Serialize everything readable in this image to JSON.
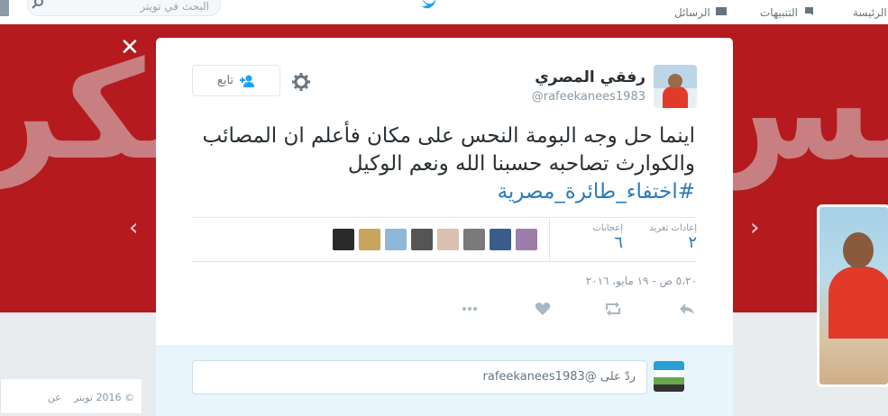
{
  "nav": {
    "home_label": "الرئيسة",
    "notifications_label": "التنبيهات",
    "messages_label": "الرسائل",
    "search_placeholder": "البحث في تويتر"
  },
  "icons": {
    "close": "close-icon",
    "settings": "gear-icon",
    "follow": "add-user-icon",
    "reply": "reply-icon",
    "retweet": "retweet-icon",
    "like": "heart-icon",
    "more": "more-icon",
    "prev": "chevron-left-icon",
    "next": "chevron-right-icon"
  },
  "colors": {
    "brand": "#1da1f2",
    "link": "#2b7bb9",
    "banner": "#b51a1e"
  },
  "tweet": {
    "author_name": "رفقي المصري",
    "author_handle": "@rafeekanees1983",
    "follow_label": "تابع",
    "text": "اينما حل وجه البومة النحس على مكان فأعلم ان المصائب والكوارث تصاحبه حسبنا الله ونعم الوكيل",
    "hashtag": "#اختفاء_طائرة_مصرية",
    "stats": {
      "retweets_label": "إعادات تغريد",
      "retweets_value": "٢",
      "likes_label": "إعجابات",
      "likes_value": "٦"
    },
    "timestamp": "٥،٢٠ ص - ١٩ مايو، ٢٠١٦"
  },
  "reply": {
    "placeholder": "ردّ على @rafeekanees1983"
  },
  "footer": {
    "copyright": "© 2016 تويتر",
    "about": "عن"
  }
}
